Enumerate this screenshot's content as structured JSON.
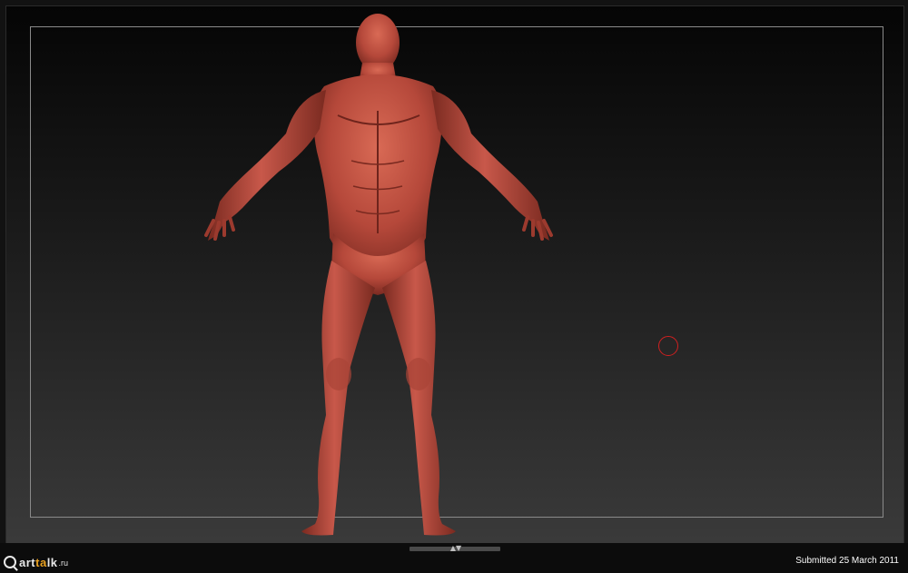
{
  "viewport": {
    "cursor": "brush-circle-cursor"
  },
  "footer": {
    "logo_prefix": "art",
    "logo_mid": "ta",
    "logo_suffix": "lk",
    "logo_tld": ".ru",
    "submitted_text": "Submitted 25 March 2011",
    "scroll_arrows": "▲▼"
  },
  "colors": {
    "model": "#b5483a",
    "cursor": "#d02020",
    "logo_accent": "#e8a020"
  }
}
